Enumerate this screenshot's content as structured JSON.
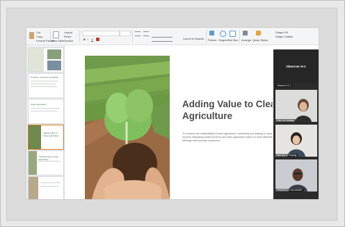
{
  "ribbon": {
    "cut_label": "Cut",
    "copy_label": "Copy",
    "paste_label": "Paste",
    "format_painter_label": "Format Painter",
    "new_slide_label": "New Slide",
    "layout_label": "Layout",
    "reset_label": "Reset",
    "section_label": "Section",
    "convert_label": "Convert to SmartArt",
    "picture_label": "Picture",
    "shapes_label": "Shapes",
    "text_box_label": "Text Box",
    "arrange_label": "Arrange",
    "quick_styles_label": "Quick Styles",
    "shape_fill_label": "Shape Fill",
    "shape_outline_label": "Shape Outline"
  },
  "thumbnails": [
    {
      "label": ""
    },
    {
      "label": "Products, Services, and Ideas"
    },
    {
      "label": "Clean Agriculture"
    },
    {
      "label": "Adding Value to Clean Agriculture"
    },
    {
      "label": "Transitioning to Clean Agriculture"
    },
    {
      "label": ""
    }
  ],
  "slide": {
    "title": "Adding Value to Clean\nAgriculture",
    "body": "To enhance the marketability of clean agriculture, embracing and thinking is essential. This involves integrating added services and clean agriculture make it a more differentiated offerings that resonate consumers."
  },
  "gallery": {
    "title": "Observer H-1",
    "participants": [
      {
        "name": "Observer H-1"
      },
      {
        "name": "Cen-Lin Lindsay"
      },
      {
        "name": "Kim Chi Yi Phuong"
      },
      {
        "name": "FREDIRICA TIA ZANEH"
      }
    ]
  },
  "colors": {
    "selected_thumb": "#d17a2a",
    "title_text": "#4a4a4a",
    "gallery_bg": "#2b2b2b"
  }
}
